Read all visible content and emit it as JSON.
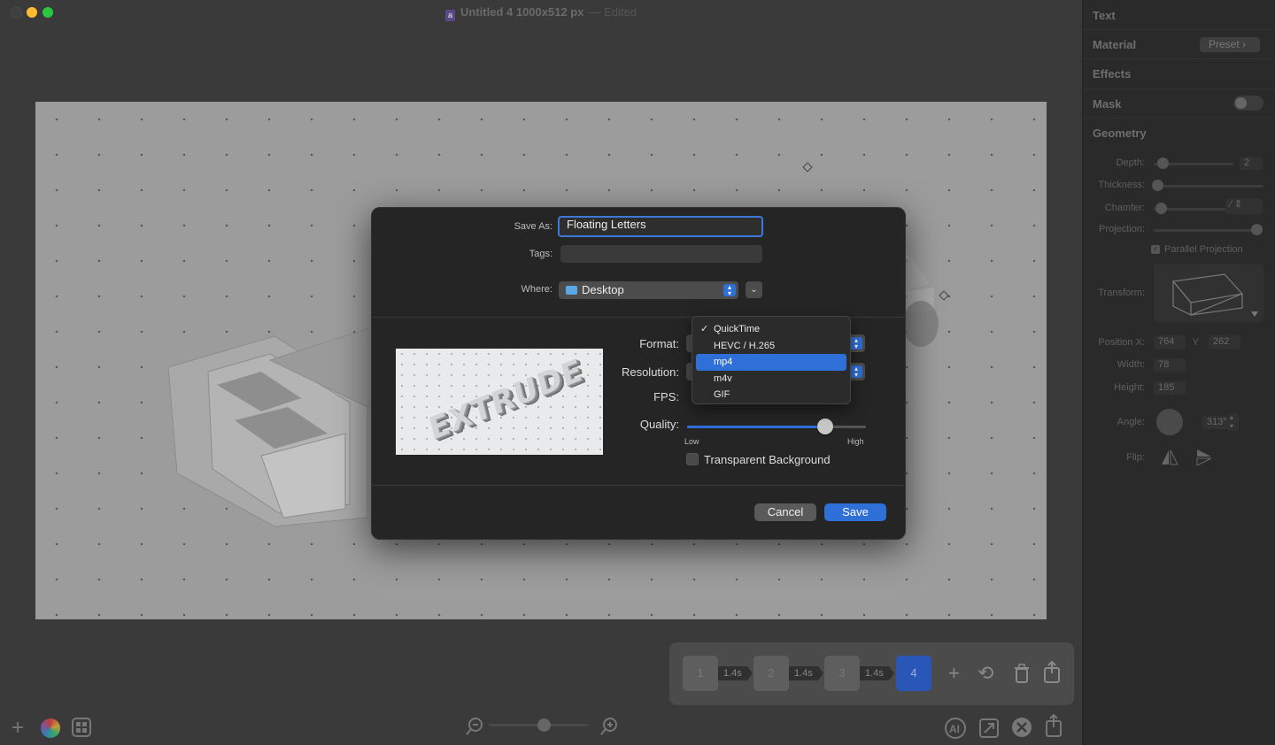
{
  "window": {
    "title": "Untitled 4 1000x512 px",
    "edited_label": "— Edited",
    "doc_icon_glyph": "a"
  },
  "dialog": {
    "save_as_label": "Save As:",
    "save_as_value": "Floating Letters",
    "tags_label": "Tags:",
    "tags_value": "",
    "where_label": "Where:",
    "where_value": "Desktop",
    "format_label": "Format:",
    "resolution_label": "Resolution:",
    "fps_label": "FPS:",
    "quality_label": "Quality:",
    "quality_low": "Low",
    "quality_high": "High",
    "quality_level": 0.77,
    "transparent_label": "Transparent Background",
    "transparent_checked": false,
    "cancel_label": "Cancel",
    "save_label": "Save",
    "preview_text": "EXTRUDE",
    "format_menu": {
      "items": [
        "QuickTime",
        "HEVC / H.265",
        "mp4",
        "m4v",
        "GIF"
      ],
      "checked": "QuickTime",
      "highlighted": "mp4"
    }
  },
  "inspector": {
    "sections": {
      "text": "Text",
      "material": "Material",
      "effects": "Effects",
      "mask": "Mask",
      "geometry": "Geometry"
    },
    "preset_label": "Preset",
    "mask_on": false,
    "geometry": {
      "depth_label": "Depth:",
      "depth_value": "2",
      "thickness_label": "Thickness:",
      "chamfer_label": "Chamfer:",
      "projection_label": "Projection:",
      "parallel_label": "Parallel Projection",
      "parallel_checked": true,
      "transform_label": "Transform:",
      "position_x_label": "Position X:",
      "position_x_value": "764",
      "y_label": "Y",
      "y_value": "262",
      "width_label": "Width:",
      "width_value": "78",
      "height_label": "Height:",
      "height_value": "185",
      "angle_label": "Angle:",
      "angle_value": "313°",
      "flip_label": "Flip:"
    }
  },
  "timeline": {
    "frames": [
      "1",
      "2",
      "3",
      "4"
    ],
    "durations": [
      "1.4s",
      "1.4s",
      "1.4s"
    ],
    "active_frame": "4"
  },
  "colors": {
    "accent": "#2f6fd8",
    "dialog_bg": "#252525",
    "inspector_bg": "#2a2a2a"
  }
}
